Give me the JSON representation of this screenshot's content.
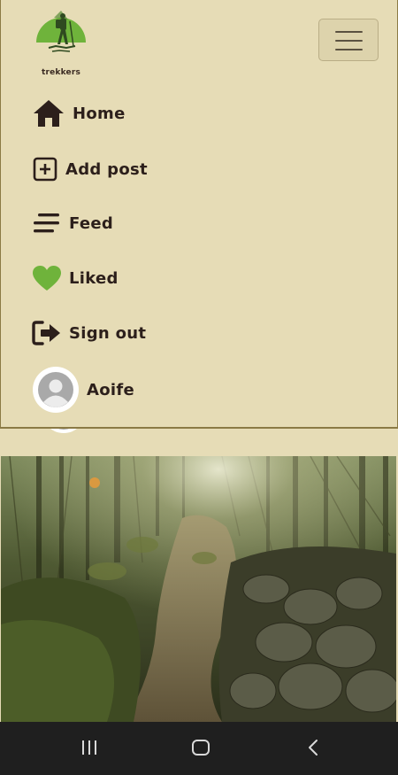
{
  "brand": {
    "name": "trekkers"
  },
  "menu": {
    "items": [
      {
        "label": "Home",
        "icon": "home-icon"
      },
      {
        "label": "Add post",
        "icon": "add-post-icon"
      },
      {
        "label": "Feed",
        "icon": "feed-icon"
      },
      {
        "label": "Liked",
        "icon": "heart-icon"
      },
      {
        "label": "Sign out",
        "icon": "sign-out-icon"
      }
    ],
    "profile": {
      "label": "Aoife",
      "icon": "avatar"
    }
  },
  "colors": {
    "background": "#e6dcb6",
    "text": "#2c1f1b",
    "brand_green": "#6fb33b",
    "border": "#8b7a45"
  },
  "system_nav": {
    "recents": "recents-icon",
    "home": "home-circle-icon",
    "back": "back-icon"
  }
}
